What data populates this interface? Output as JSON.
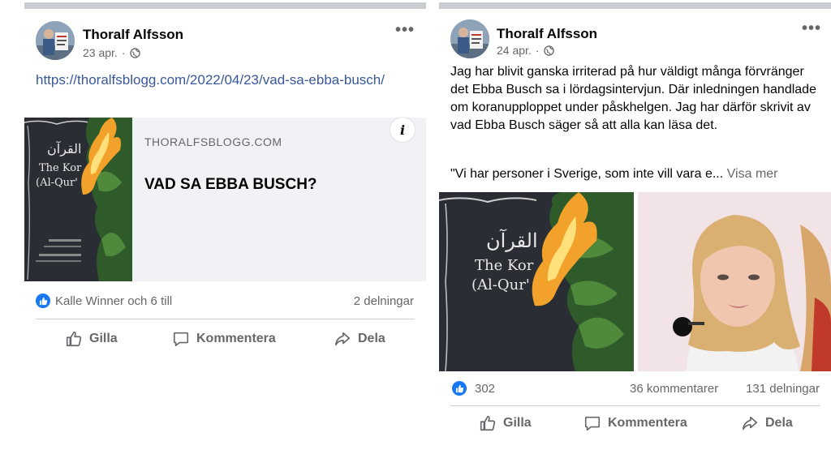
{
  "posts": [
    {
      "author": "Thoralf Alfsson",
      "date": "23 apr.",
      "more_icon": "more-icon",
      "link_url_text": "https://thoralfsblogg.com/2022/04/23/vad-sa-ebba-busch/",
      "link_preview": {
        "domain": "THORALFSBLOGG.COM",
        "title": "VAD SA EBBA BUSCH?",
        "info": "i",
        "image_text": {
          "arabic": "القرآن",
          "line1": "The Kor",
          "line2": "(Al-Qur'"
        }
      },
      "reactions": "Kalle Winner och 6 till",
      "shares": "2 delningar",
      "actions": {
        "like": "Gilla",
        "comment": "Kommentera",
        "share": "Dela"
      }
    },
    {
      "author": "Thoralf Alfsson",
      "date": "24 apr.",
      "body": "Jag har blivit ganska irriterad på hur väldigt många förvränger det Ebba Busch sa i lördagsintervjun. Där inledningen handlade om koranupploppet under påskhelgen. Jag har därför skrivit av vad Ebba Busch säger så att alla kan läsa det.",
      "quote": "\"Vi har personer i Sverige, som inte vill vara e...",
      "see_more": "Visa mer",
      "image_text": {
        "arabic": "القرآن",
        "line1": "The Kor",
        "line2": "(Al-Qur'"
      },
      "reaction_count": "302",
      "comments": "36 kommentarer",
      "shares": "131 delningar",
      "actions": {
        "like": "Gilla",
        "comment": "Kommentera",
        "share": "Dela"
      }
    }
  ],
  "colors": {
    "link": "#385898",
    "accent": "#1877f2",
    "muted": "#65676b"
  }
}
